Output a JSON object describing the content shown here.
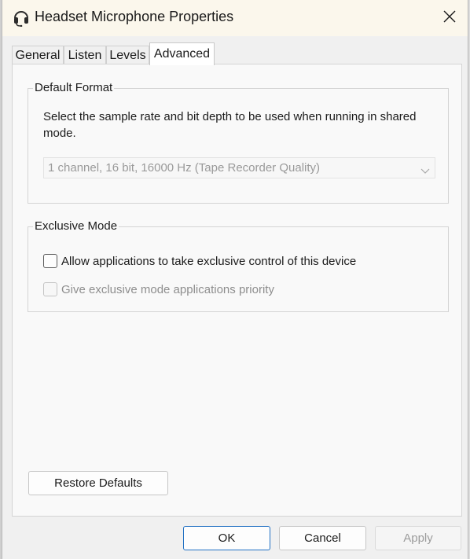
{
  "window": {
    "title": "Headset Microphone Properties",
    "icon": "headset-icon",
    "close_icon": "close-icon"
  },
  "tabs": [
    {
      "label": "General",
      "active": false
    },
    {
      "label": "Listen",
      "active": false
    },
    {
      "label": "Levels",
      "active": false
    },
    {
      "label": "Advanced",
      "active": true
    }
  ],
  "default_format": {
    "legend": "Default Format",
    "description": "Select the sample rate and bit depth to be used when running in shared mode.",
    "selected_value": "1 channel, 16 bit, 16000 Hz (Tape Recorder Quality)",
    "enabled": false
  },
  "exclusive_mode": {
    "legend": "Exclusive Mode",
    "allow_exclusive": {
      "label": "Allow applications to take exclusive control of this device",
      "checked": false,
      "enabled": true
    },
    "exclusive_priority": {
      "label": "Give exclusive mode applications priority",
      "checked": false,
      "enabled": false
    }
  },
  "restore_defaults_label": "Restore Defaults",
  "footer": {
    "ok_label": "OK",
    "cancel_label": "Cancel",
    "apply_label": "Apply"
  },
  "colors": {
    "titlebar": "#fbf7ec",
    "accent": "#1f6fc2",
    "disabled_text": "#9a9a9a"
  }
}
